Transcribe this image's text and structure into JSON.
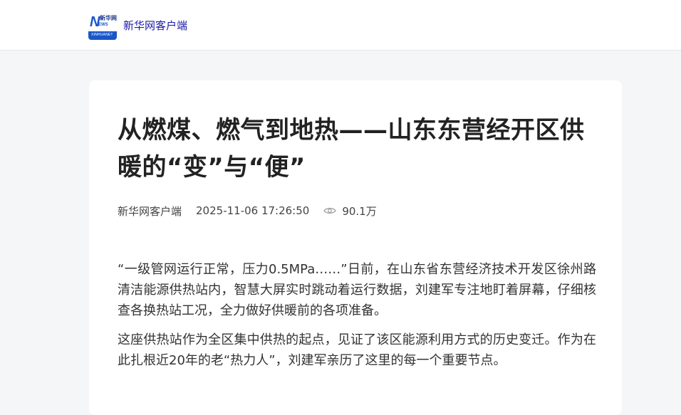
{
  "header": {
    "logo": {
      "letter": "N",
      "small_text": "EWS",
      "cn_text": "新华网",
      "bottom_text": "XINHUANET"
    },
    "site_name": "新华网客户端"
  },
  "article": {
    "title": "从燃煤、燃气到地热——山东东营经开区供暖的“变”与“便”",
    "meta": {
      "source": "新华网客户端",
      "datetime": "2025-11-06 17:26:50",
      "view_icon": "eye-icon",
      "views": "90.1万"
    },
    "paragraphs": [
      "“一级管网运行正常，压力0.5MPa……”日前，在山东省东营经济技术开发区徐州路清洁能源供热站内，智慧大屏实时跳动着运行数据，刘建军专注地盯着屏幕，仔细核查各换热站工况，全力做好供暖前的各项准备。",
      "这座供热站作为全区集中供热的起点，见证了该区能源利用方式的历史变迁。作为在此扎根近20年的老“热力人”，刘建军亲历了这里的每一个重要节点。"
    ]
  },
  "colors": {
    "page_bg": "#f5f6f8",
    "brand_blue": "#1a56c8",
    "site_name_color": "#1a1aa6",
    "title_color": "#222222",
    "body_text": "#333333"
  }
}
